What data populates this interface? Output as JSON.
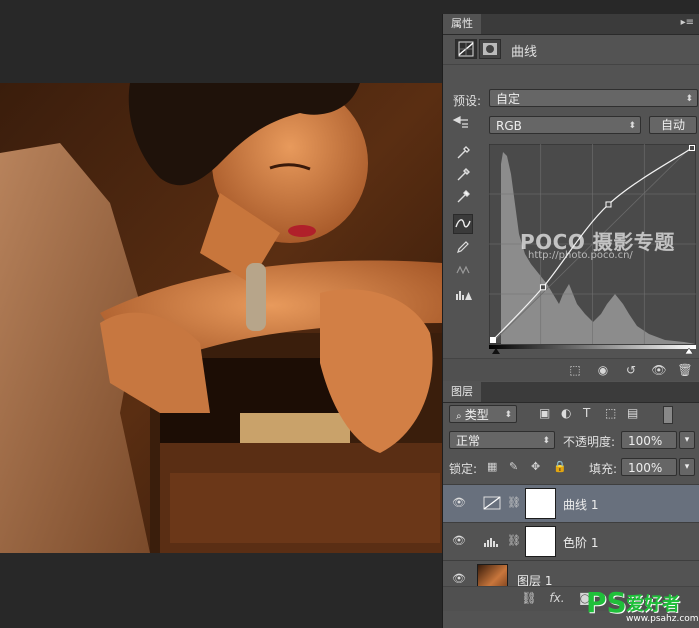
{
  "properties": {
    "tab_label": "属性",
    "panel_title": "曲线",
    "preset_label": "预设:",
    "preset_value": "自定",
    "channel_value": "RGB",
    "auto_button": "自动",
    "icons": [
      "curves-adjustment-icon",
      "layer-mask-icon",
      "target-adjust-icon",
      "eyedropper-black-icon",
      "eyedropper-gray-icon",
      "eyedropper-white-icon",
      "curve-point-tool-icon",
      "pencil-icon",
      "smooth-icon",
      "clipping-warning-icon"
    ],
    "footer_icons": [
      "clip-to-layer-icon",
      "view-previous-icon",
      "reset-icon",
      "visibility-icon",
      "delete-icon"
    ],
    "curve": {
      "points": [
        [
          0,
          0
        ],
        [
          64,
          70
        ],
        [
          148,
          180
        ],
        [
          255,
          255
        ]
      ],
      "range": [
        0,
        255
      ]
    }
  },
  "layers": {
    "tab_label": "图层",
    "filter_kind": "类型",
    "blend_mode": "正常",
    "opacity_label": "不透明度:",
    "opacity_value": "100%",
    "lock_label": "锁定:",
    "fill_label": "填充:",
    "fill_value": "100%",
    "items": [
      {
        "name": "曲线 1",
        "type": "curves",
        "selected": true
      },
      {
        "name": "色阶 1",
        "type": "levels",
        "selected": false
      },
      {
        "name": "图层 1",
        "type": "image",
        "selected": false
      }
    ],
    "footer_icons": [
      "link-layers-icon",
      "fx-icon",
      "add-mask-icon"
    ]
  },
  "watermarks": {
    "poco": "POCO 摄影专题",
    "poco_url": "http://photo.poco.cn/",
    "ps_logo": "PS",
    "ps_text": "爱好者",
    "ps_url": "www.psahz.com"
  },
  "colors": {
    "panel_bg": "#535353",
    "selected_layer": "#68707d",
    "dark_chrome": "#282828"
  }
}
